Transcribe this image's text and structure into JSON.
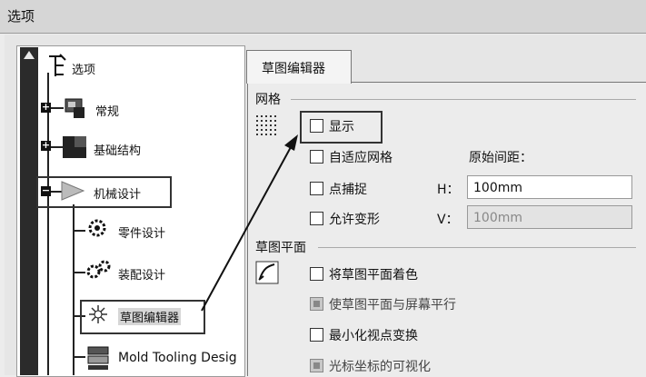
{
  "window": {
    "title": "选项"
  },
  "tree": {
    "root": {
      "label": "选项"
    },
    "items": [
      {
        "label": "常规"
      },
      {
        "label": "基础结构"
      },
      {
        "label": "机械设计"
      },
      {
        "label": "零件设计"
      },
      {
        "label": "装配设计"
      },
      {
        "label": "草图编辑器"
      },
      {
        "label": "Mold Tooling Desig"
      }
    ]
  },
  "tab": {
    "label": "草图编辑器"
  },
  "grid_section": {
    "title": "网格",
    "show": "显示",
    "adaptive": "自适应网格",
    "spacing_label": "原始间距：",
    "snap": "点捕捉",
    "h_label": "H：",
    "h_value": "100mm",
    "allow_distortion": "允许变形",
    "v_label": "V：",
    "v_value": "100mm"
  },
  "plane_section": {
    "title": "草图平面",
    "shade": "将草图平面着色",
    "parallel": "使草图平面与屏幕平行",
    "minimize": "最小化视点变换",
    "cursor": "光标坐标的可视化"
  }
}
